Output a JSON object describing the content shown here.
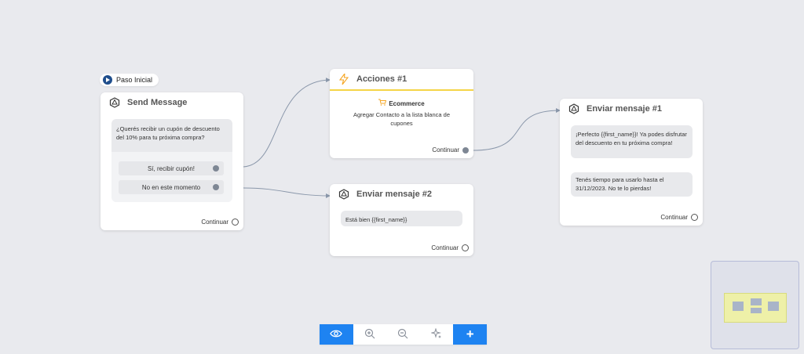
{
  "start": {
    "label": "Paso Inicial"
  },
  "node_send": {
    "title": "Send Message",
    "question": "¿Querés recibir un cupón de descuento del 10% para tu próxima compra?",
    "options": [
      "Sí, recibir cupón!",
      "No en este momento"
    ],
    "continue": "Continuar"
  },
  "node_actions": {
    "title": "Acciones #1",
    "category": "Ecommerce",
    "description": "Agregar Contacto a la lista blanca de cupones",
    "continue": "Continuar"
  },
  "node_msg2": {
    "title": "Enviar mensaje #2",
    "message": "Está bien {{first_name}}",
    "continue": "Continuar"
  },
  "node_msg1": {
    "title": "Enviar mensaje #1",
    "message1": "¡Perfecto {{first_name}}! Ya podes disfrutar del descuento en tu próxima compra!",
    "message2": "Tenés tiempo para usarlo hasta el 31/12/2023. No te lo pierdas!",
    "continue": "Continuar"
  },
  "toolbar": {
    "buttons": [
      "eye-icon",
      "zoom-in-icon",
      "zoom-out-icon",
      "sparkle-icon",
      "plus-icon"
    ]
  },
  "colors": {
    "accent": "#1e83f1",
    "action_line": "#f5d547",
    "edge": "#8a97aa"
  }
}
